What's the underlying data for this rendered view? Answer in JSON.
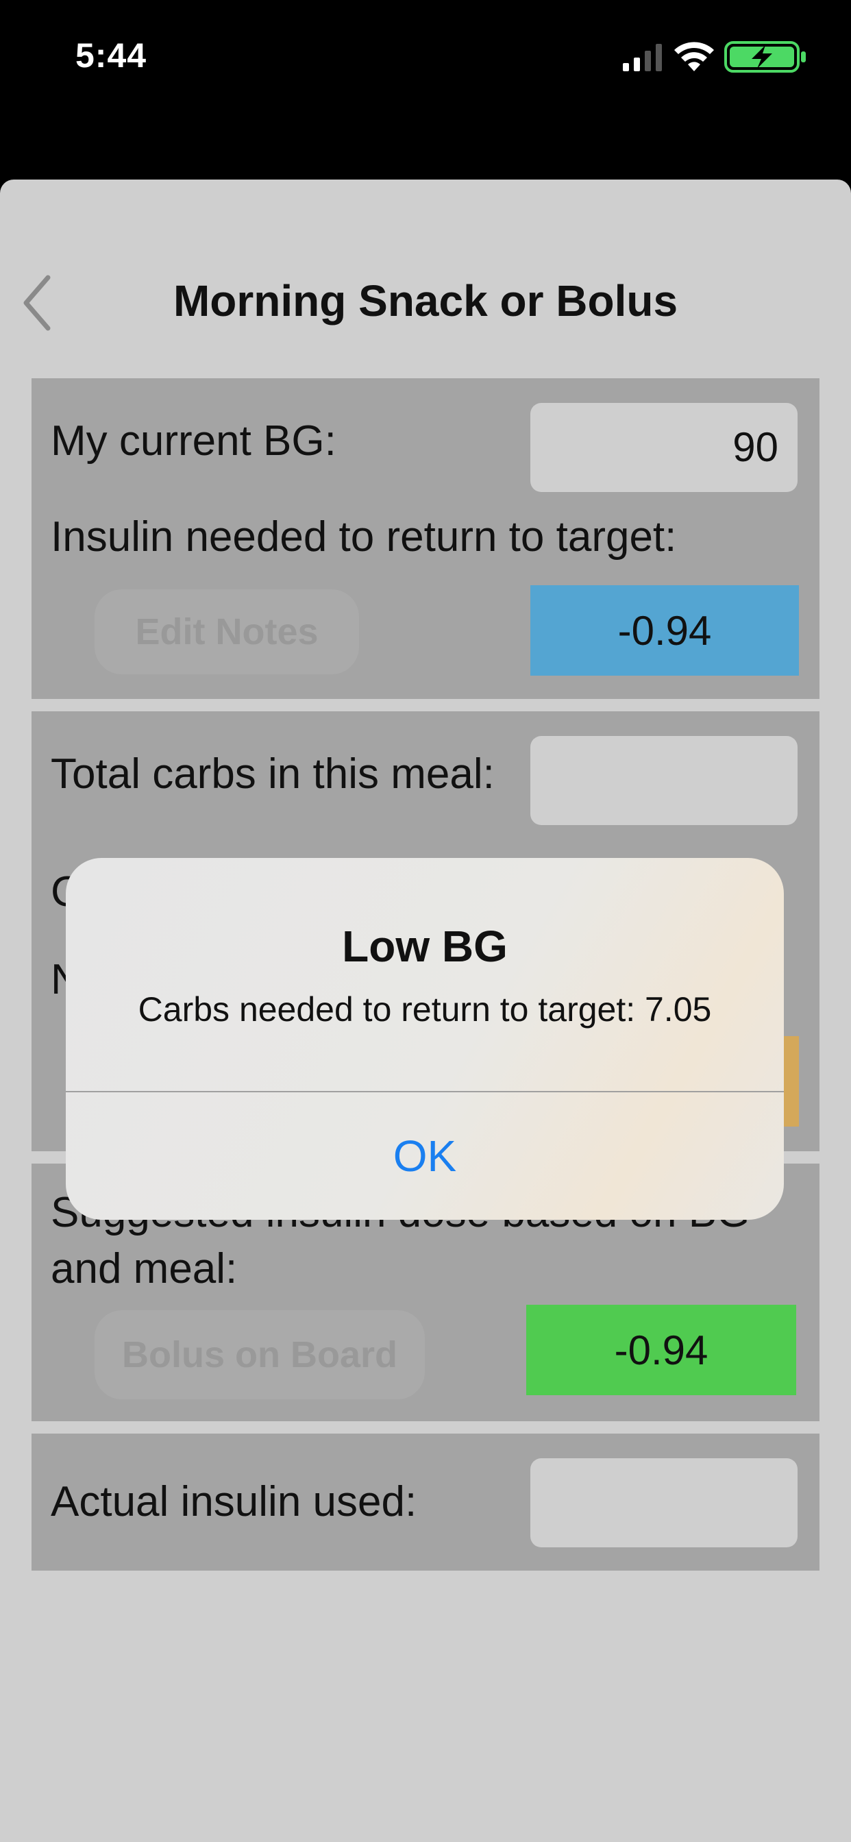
{
  "status_bar": {
    "time": "5:44",
    "signal_icon": "cellular-signal-icon",
    "wifi_icon": "wifi-icon",
    "battery_icon": "battery-charging-icon",
    "battery_color": "#4cd964"
  },
  "nav": {
    "title": "Morning Snack or Bolus",
    "back_icon": "chevron-left-icon"
  },
  "bg_section": {
    "current_bg_label": "My current BG:",
    "current_bg_value": "90",
    "insulin_needed_label": "Insulin needed to return to target:",
    "insulin_needed_value": "-0.94",
    "insulin_needed_color": "#54a5d2",
    "edit_notes_label": "Edit Notes"
  },
  "carbs_section": {
    "total_carbs_label": "Total carbs in this meal:",
    "total_carbs_value": "",
    "hidden_row_1_initial": "C",
    "hidden_row_2_initial": "N",
    "hidden_value_color": "#d4a85a"
  },
  "suggested_section": {
    "label_line1": "Suggested insulin dose based on BG",
    "label_line2": "and meal:",
    "value": "-0.94",
    "value_color": "#50cb50",
    "bolus_on_board_label": "Bolus on Board"
  },
  "actual_section": {
    "label": "Actual insulin used:",
    "value": ""
  },
  "alert": {
    "title": "Low BG",
    "message": "Carbs needed to return to target: 7.05",
    "ok_label": "OK",
    "ok_color": "#1a7ff0"
  }
}
